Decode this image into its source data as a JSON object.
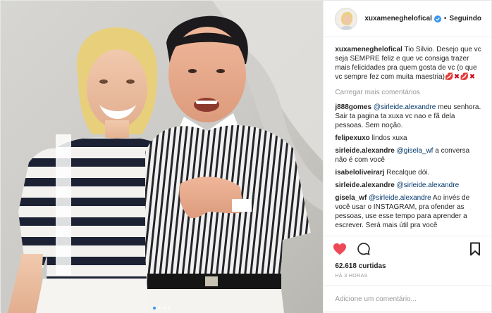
{
  "photo": {
    "description_icon": "photo",
    "dots": 4,
    "active_dot": 1
  },
  "header": {
    "username": "xuxameneghelofical",
    "separator": "•",
    "follow_label": "Seguindo",
    "verified_icon": "verified-badge-icon"
  },
  "caption": {
    "username": "xuxameneghelofical",
    "text": "Tio Silvio. Desejo que vc seja SEMPRE feliz e que vc consiga trazer mais felicidades pra quem gosta de vc (o que vc sempre fez com muita maestria)",
    "emoji": "💋✖💋✖"
  },
  "load_more": "Carregar mais comentários",
  "comments": [
    {
      "username": "j888gomes",
      "mention": "@sirleide.alexandre",
      "text": " meu senhora. Sair ta pagina ta xuxa vc nao e fã dela pessoas. Sem noção."
    },
    {
      "username": "felipexuxo",
      "mention": "",
      "text": "lindos xuxa"
    },
    {
      "username": "sirleide.alexandre",
      "mention": "@gisela_wf",
      "text": " a conversa não é com você"
    },
    {
      "username": "isabeloliveirarj",
      "mention": "",
      "text": "Recalque dói."
    },
    {
      "username": "sirleide.alexandre",
      "mention": "@sirleide.alexandre",
      "text": ""
    },
    {
      "username": "gisela_wf",
      "mention": "@sirleide.alexandre",
      "text": " Ao invés de você usar o INSTAGRAM, pra ofender as pessoas, use esse tempo para aprender a escrever. Será mais útil pra você"
    }
  ],
  "likes": "62.618 curtidas",
  "time": "HÁ 3 HORAS",
  "add_comment_placeholder": "Adicione um comentário...",
  "colors": {
    "like": "#ed4956",
    "link": "#003569",
    "muted": "#999999",
    "verified": "#3897f0"
  }
}
